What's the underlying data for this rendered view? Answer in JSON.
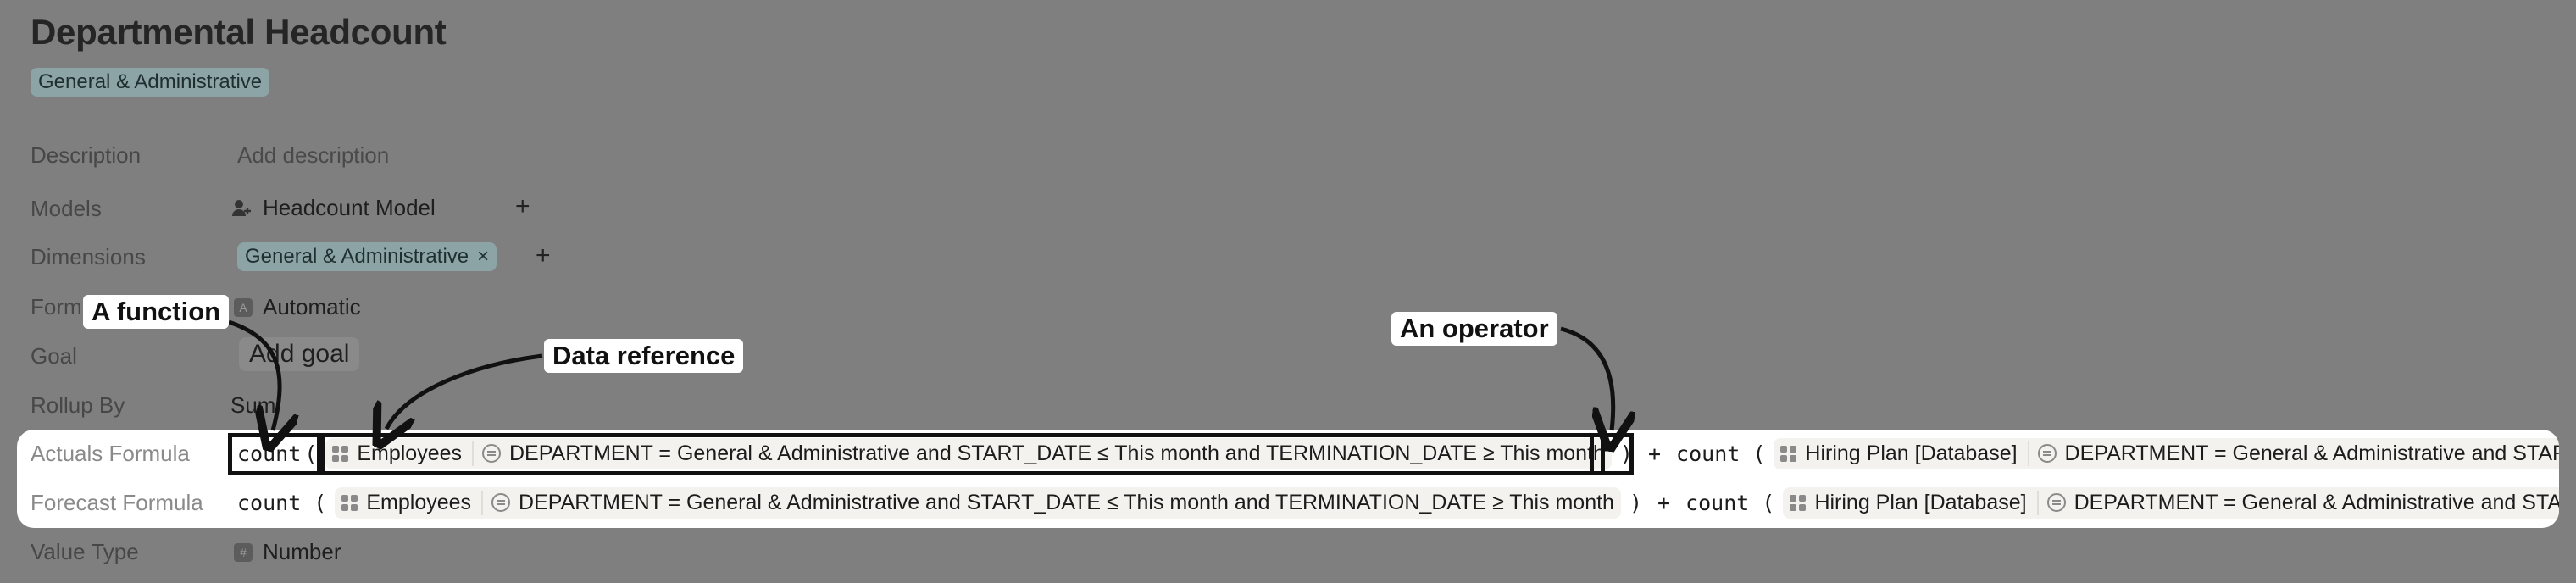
{
  "page": {
    "title": "Departmental Headcount",
    "tag": "General & Administrative"
  },
  "fields": {
    "description": {
      "label": "Description",
      "placeholder": "Add description"
    },
    "models": {
      "label": "Models",
      "value": "Headcount Model",
      "add": "+"
    },
    "dimensions": {
      "label": "Dimensions",
      "chip": "General & Administrative",
      "remove": "×",
      "add": "+"
    },
    "format": {
      "label": "Form",
      "value": "Automatic"
    },
    "goal": {
      "label": "Goal",
      "button": "Add goal"
    },
    "rollup": {
      "label": "Rollup By",
      "value": "Sum"
    },
    "value_type": {
      "label": "Value Type",
      "value": "Number"
    }
  },
  "formulas": {
    "actuals": {
      "label": "Actuals Formula",
      "fn1": "count",
      "paren_open": "(",
      "ref1": "Employees",
      "filter1": "DEPARTMENT = General & Administrative and START_DATE ≤ This month and TERMINATION_DATE ≥ This month",
      "paren_close": ")",
      "op": "+",
      "fn2": "count (",
      "ref2": "Hiring Plan [Database]",
      "filter2": "DEPARTMENT = General & Administrative and START_D"
    },
    "forecast": {
      "label": "Forecast Formula",
      "fn1": "count (",
      "ref1": "Employees",
      "filter1": "DEPARTMENT = General & Administrative and START_DATE ≤ This month and TERMINATION_DATE ≥ This month",
      "paren_close": ")",
      "op": "+",
      "fn2": "count (",
      "ref2": "Hiring Plan [Database]",
      "filter2": "DEPARTMENT = General & Administrative and START_D"
    }
  },
  "annotations": {
    "function": "A function",
    "data_reference": "Data reference",
    "operator": "An operator"
  },
  "icons": [
    "user-plus-icon",
    "tag-icon",
    "grid-icon",
    "filter-icon",
    "number-icon"
  ]
}
